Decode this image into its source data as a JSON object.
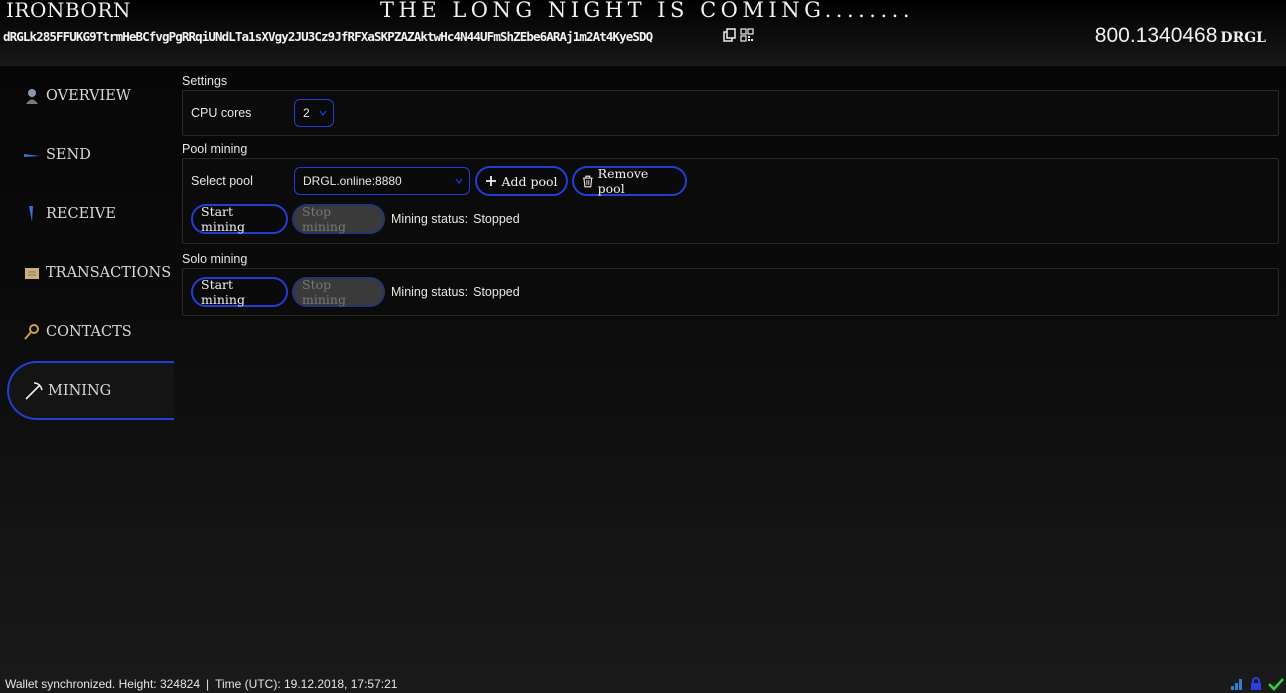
{
  "header": {
    "app_title": "IRONBORN",
    "tagline": "THE LONG NIGHT IS COMING........",
    "address": "dRGLk285FFUKG9TtrmHeBCfvgPgRRqiUNdLTa1sXVgy2JU3Cz9JfRFXaSKPZAZAktwHc4N44UFmShZEbe6ARAj1m2At4KyeSDQ",
    "balance": "800.1340468",
    "ticker": "DRGL",
    "icons": [
      "copy-icon",
      "qr-code-icon"
    ]
  },
  "sidebar": {
    "items": [
      {
        "label": "OVERVIEW",
        "icon": "overview-icon"
      },
      {
        "label": "SEND",
        "icon": "send-icon"
      },
      {
        "label": "RECEIVE",
        "icon": "receive-icon"
      },
      {
        "label": "TRANSACTIONS",
        "icon": "transactions-icon"
      },
      {
        "label": "CONTACTS",
        "icon": "contacts-icon"
      },
      {
        "label": "MINING",
        "icon": "pickaxe-icon",
        "active": true
      }
    ]
  },
  "settings": {
    "title": "Settings",
    "cpu_label": "CPU cores",
    "cpu_value": "2"
  },
  "pool": {
    "title": "Pool mining",
    "select_label": "Select pool",
    "selected_pool": "DRGL.online:8880",
    "add_pool": "Add pool",
    "remove_pool": "Remove pool",
    "start": "Start mining",
    "stop": "Stop mining",
    "status_label": "Mining status:",
    "status_value": "Stopped"
  },
  "solo": {
    "title": "Solo mining",
    "start": "Start mining",
    "stop": "Stop mining",
    "status_label": "Mining status:",
    "status_value": "Stopped"
  },
  "statusbar": {
    "sync": "Wallet synchronized. Height: 324824",
    "separator": "|",
    "time": "Time (UTC): 19.12.2018, 17:57:21",
    "icons": [
      "signal-icon",
      "lock-icon",
      "check-icon"
    ],
    "colors": {
      "signal": "#2f7fd0",
      "lock": "#2b3fe0",
      "check": "#2ecc40"
    }
  },
  "accent_color": "#1f3fd6"
}
